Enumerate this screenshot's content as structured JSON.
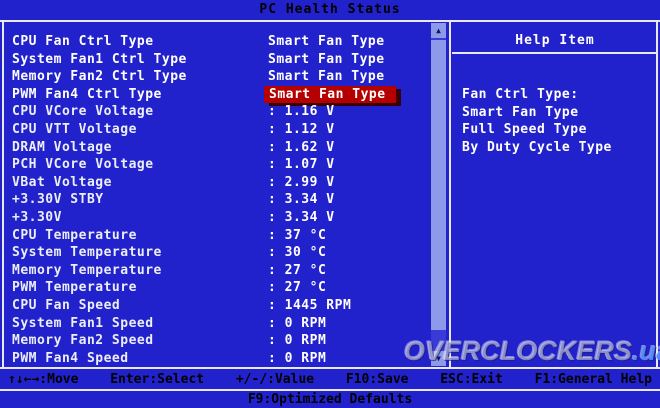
{
  "title": "PC Health Status",
  "items": [
    {
      "label": "CPU Fan Ctrl Type",
      "value": "Smart Fan Type",
      "editable": true,
      "selected": false
    },
    {
      "label": "System Fan1 Ctrl Type",
      "value": "Smart Fan Type",
      "editable": true,
      "selected": false
    },
    {
      "label": "Memory Fan2 Ctrl Type",
      "value": "Smart Fan Type",
      "editable": true,
      "selected": false
    },
    {
      "label": "PWM Fan4 Ctrl Type",
      "value": "Smart Fan Type",
      "editable": true,
      "selected": true
    },
    {
      "label": "CPU VCore Voltage",
      "value": ": 1.16 V",
      "editable": false,
      "selected": false
    },
    {
      "label": "CPU VTT Voltage",
      "value": ": 1.12 V",
      "editable": false,
      "selected": false
    },
    {
      "label": "DRAM Voltage",
      "value": ": 1.62 V",
      "editable": false,
      "selected": false
    },
    {
      "label": "PCH VCore Voltage",
      "value": ": 1.07 V",
      "editable": false,
      "selected": false
    },
    {
      "label": "VBat Voltage",
      "value": ": 2.99 V",
      "editable": false,
      "selected": false
    },
    {
      "label": "+3.30V STBY",
      "value": ": 3.34 V",
      "editable": false,
      "selected": false
    },
    {
      "label": "+3.30V",
      "value": ": 3.34 V",
      "editable": false,
      "selected": false
    },
    {
      "label": "CPU Temperature",
      "value": ": 37 °C",
      "editable": false,
      "selected": false
    },
    {
      "label": "System Temperature",
      "value": ": 30 °C",
      "editable": false,
      "selected": false
    },
    {
      "label": "Memory Temperature",
      "value": ": 27 °C",
      "editable": false,
      "selected": false
    },
    {
      "label": "PWM Temperature",
      "value": ": 27 °C",
      "editable": false,
      "selected": false
    },
    {
      "label": "CPU Fan Speed",
      "value": ": 1445 RPM",
      "editable": false,
      "selected": false
    },
    {
      "label": "System Fan1 Speed",
      "value": ": 0 RPM",
      "editable": false,
      "selected": false
    },
    {
      "label": "Memory Fan2 Speed",
      "value": ": 0 RPM",
      "editable": false,
      "selected": false
    },
    {
      "label": "PWM Fan4 Speed",
      "value": ": 0 RPM",
      "editable": false,
      "selected": false
    }
  ],
  "help": {
    "header": "Help Item",
    "lines": [
      "Fan Ctrl Type:",
      "Smart Fan Type",
      "Full Speed Type",
      "By Duty Cycle Type"
    ]
  },
  "scrollbar": {
    "up_glyph": "▲",
    "down_glyph": "▼"
  },
  "footer": {
    "keys": [
      "↑↓←→:Move",
      "Enter:Select",
      "+/-/:Value",
      "F10:Save",
      "ESC:Exit",
      "F1:General Help"
    ],
    "defaults": "F9:Optimized Defaults"
  },
  "watermark": {
    "text": "OVERCLOCKERS",
    "suffix": ".ua"
  },
  "colors": {
    "background": "#2222cc",
    "highlight_red": "#b40000",
    "item_text": "#ffffff",
    "hint_text": "#000000",
    "scrollbar": "#8d99ea",
    "border": "#e8e8f8"
  }
}
